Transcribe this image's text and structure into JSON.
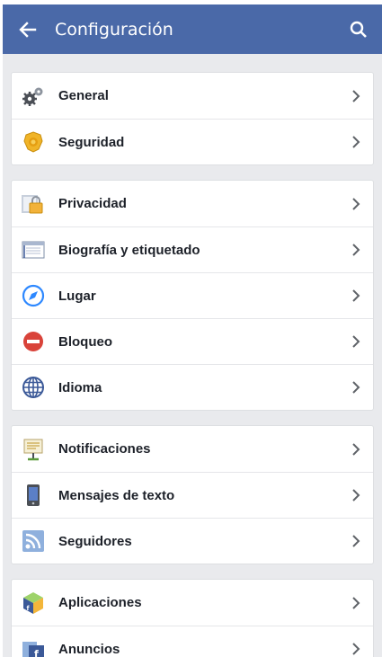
{
  "appbar": {
    "title": "Configuración",
    "back_icon": "arrow-left-icon",
    "search_icon": "search-icon",
    "color": "#4a69a8"
  },
  "groups": [
    {
      "items": [
        {
          "label": "General",
          "icon": "gears-icon"
        },
        {
          "label": "Seguridad",
          "icon": "security-badge-icon"
        }
      ]
    },
    {
      "items": [
        {
          "label": "Privacidad",
          "icon": "lock-icon"
        },
        {
          "label": "Biografía y etiquetado",
          "icon": "timeline-icon"
        },
        {
          "label": "Lugar",
          "icon": "compass-icon"
        },
        {
          "label": "Bloqueo",
          "icon": "block-icon"
        },
        {
          "label": "Idioma",
          "icon": "globe-icon"
        }
      ]
    },
    {
      "items": [
        {
          "label": "Notificaciones",
          "icon": "notification-sign-icon"
        },
        {
          "label": "Mensajes de texto",
          "icon": "phone-icon"
        },
        {
          "label": "Seguidores",
          "icon": "rss-icon"
        }
      ]
    },
    {
      "items": [
        {
          "label": "Aplicaciones",
          "icon": "apps-cube-icon"
        },
        {
          "label": "Anuncios",
          "icon": "ads-icon"
        }
      ]
    }
  ]
}
